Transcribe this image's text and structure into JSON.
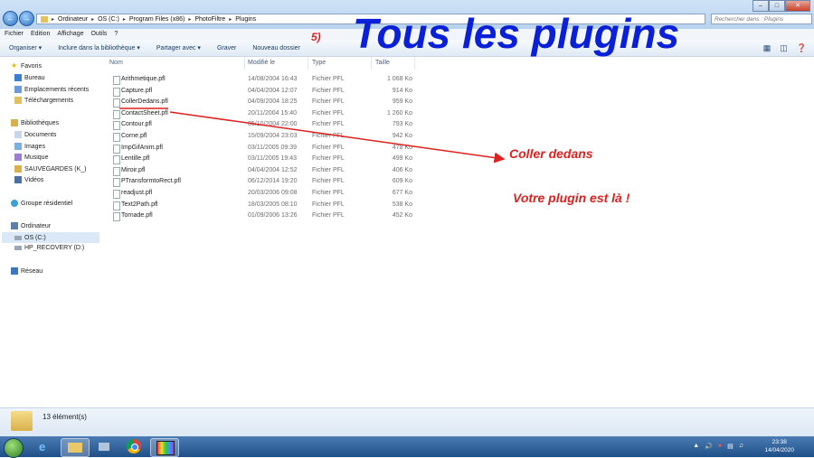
{
  "breadcrumb": [
    "Ordinateur",
    "OS (C:)",
    "Program Files (x86)",
    "PhotoFiltre",
    "Plugins"
  ],
  "search_placeholder": "Rechercher dans : Plugins",
  "menu": [
    "Fichier",
    "Edition",
    "Affichage",
    "Outils",
    "?"
  ],
  "toolbar": {
    "organize": "Organiser ▾",
    "include": "Inclure dans la bibliothèque ▾",
    "share": "Partager avec ▾",
    "burn": "Graver",
    "new_folder": "Nouveau dossier"
  },
  "sidebar": {
    "favorites": "Favoris",
    "fav_items": [
      "Bureau",
      "Emplacements récents",
      "Téléchargements"
    ],
    "libraries": "Bibliothèques",
    "lib_items": [
      "Documents",
      "Images",
      "Musique",
      "SAUVEGARDES (K_)",
      "Vidéos"
    ],
    "homegroup": "Groupe résidentiel",
    "computer": "Ordinateur",
    "computer_items": [
      "OS (C:)",
      "HP_RECOVERY (D:)"
    ],
    "network": "Réseau"
  },
  "columns": [
    "Nom",
    "Modifié le",
    "Type",
    "Taille"
  ],
  "files": [
    {
      "name": "Arithmetique.pfl",
      "date": "14/08/2004 16:43",
      "type": "Fichier PFL",
      "size": "1 068 Ko"
    },
    {
      "name": "Capture.pfl",
      "date": "04/04/2004 12:07",
      "type": "Fichier PFL",
      "size": "914 Ko"
    },
    {
      "name": "CollerDedans.pfl",
      "date": "04/09/2004 18:25",
      "type": "Fichier PFL",
      "size": "959 Ko"
    },
    {
      "name": "ContactSheet.pfl",
      "date": "20/11/2004 15:40",
      "type": "Fichier PFL",
      "size": "1 260 Ko"
    },
    {
      "name": "Contour.pfl",
      "date": "05/10/2004 22:00",
      "type": "Fichier PFL",
      "size": "793 Ko"
    },
    {
      "name": "Corne.pfl",
      "date": "15/09/2004 23:03",
      "type": "Fichier PFL",
      "size": "942 Ko"
    },
    {
      "name": "ImpGifAnim.pfl",
      "date": "03/11/2005 09:39",
      "type": "Fichier PFL",
      "size": "478 Ko"
    },
    {
      "name": "Lentille.pfl",
      "date": "03/11/2005 19:43",
      "type": "Fichier PFL",
      "size": "499 Ko"
    },
    {
      "name": "Miroir.pfl",
      "date": "04/04/2004 12:52",
      "type": "Fichier PFL",
      "size": "406 Ko"
    },
    {
      "name": "PTransformtoRect.pfl",
      "date": "06/12/2014 19:20",
      "type": "Fichier PFL",
      "size": "609 Ko"
    },
    {
      "name": "readjust.pfl",
      "date": "20/03/2006 09:08",
      "type": "Fichier PFL",
      "size": "677 Ko"
    },
    {
      "name": "Text2Path.pfl",
      "date": "18/03/2005 08:10",
      "type": "Fichier PFL",
      "size": "538 Ko"
    },
    {
      "name": "Tornade.pfl",
      "date": "01/09/2006 13:26",
      "type": "Fichier PFL",
      "size": "452 Ko"
    }
  ],
  "status": "13 élément(s)",
  "clock": {
    "time": "23:38",
    "date": "14/04/2020"
  },
  "annotations": {
    "title": "Tous les plugins",
    "step": "5)",
    "arrow_label": "Coller dedans",
    "note": "Votre plugin est là !"
  },
  "colors": {
    "title": "#0a1fd8",
    "annotation": "#e0201e"
  }
}
